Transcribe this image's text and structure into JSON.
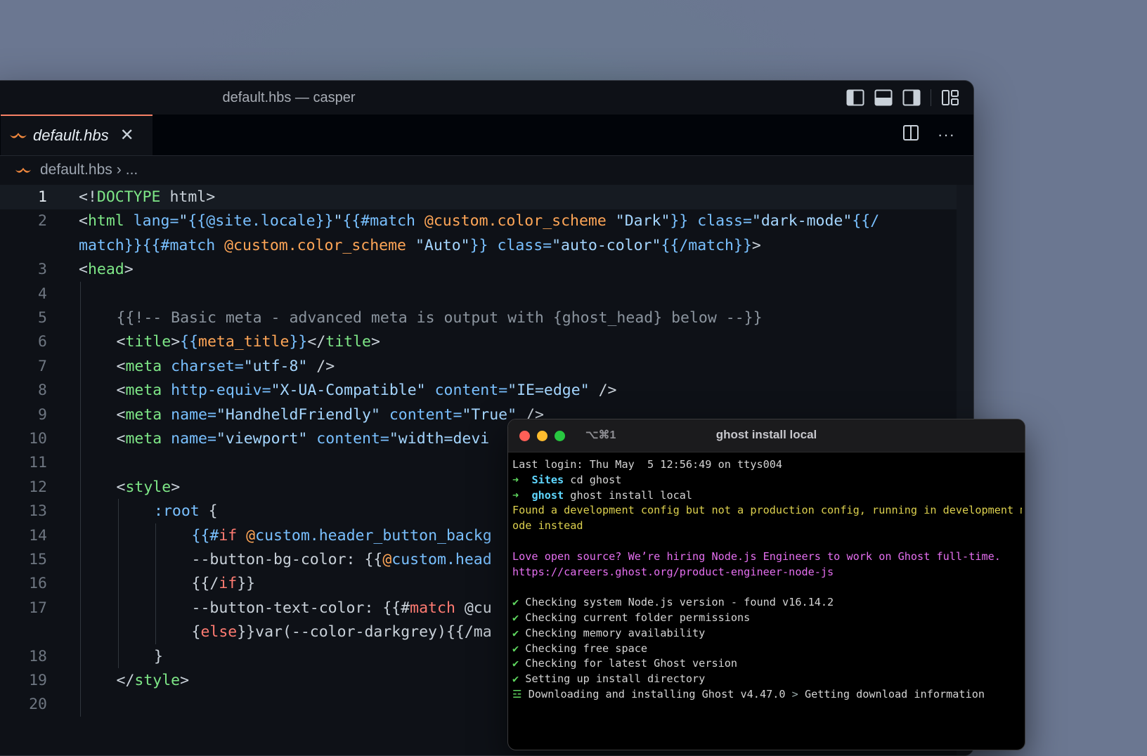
{
  "editor": {
    "window_title": "default.hbs — casper",
    "tab": {
      "label": "default.hbs",
      "close": "✕"
    },
    "more_actions": "···",
    "breadcrumb": {
      "file": "default.hbs",
      "separator": "›",
      "rest": "..."
    }
  },
  "code_lines": [
    {
      "n": "1",
      "indent": 0,
      "tokens": [
        [
          "punc",
          "<!"
        ],
        [
          "tag",
          "DOCTYPE"
        ],
        [
          "punc",
          " html>"
        ]
      ]
    },
    {
      "n": "2",
      "indent": 0,
      "tokens": [
        [
          "punc",
          "<"
        ],
        [
          "tag",
          "html"
        ],
        [
          "attr",
          " lang="
        ],
        [
          "str",
          "\""
        ],
        [
          "hb",
          "{{@site.locale}}"
        ],
        [
          "str",
          "\""
        ],
        [
          "hb",
          "{{#match "
        ],
        [
          "var",
          "@custom.color_scheme"
        ],
        [
          "str",
          " \"Dark\""
        ],
        [
          "hb",
          "}}"
        ],
        [
          "attr",
          " class="
        ],
        [
          "str",
          "\"dark-mode\""
        ],
        [
          "hb",
          "{{/"
        ]
      ]
    },
    {
      "n": "",
      "indent": 0,
      "tokens": [
        [
          "hb",
          "match}}{{#match "
        ],
        [
          "var",
          "@custom.color_scheme"
        ],
        [
          "str",
          " \"Auto\""
        ],
        [
          "hb",
          "}}"
        ],
        [
          "attr",
          " class="
        ],
        [
          "str",
          "\"auto-color\""
        ],
        [
          "hb",
          "{{/match}}"
        ],
        [
          "punc",
          ">"
        ]
      ]
    },
    {
      "n": "3",
      "indent": 0,
      "tokens": [
        [
          "punc",
          "<"
        ],
        [
          "tag",
          "head"
        ],
        [
          "punc",
          ">"
        ]
      ]
    },
    {
      "n": "4",
      "indent": 0,
      "tokens": []
    },
    {
      "n": "5",
      "indent": 1,
      "tokens": [
        [
          "cmt",
          "{{!-- Basic meta - advanced meta is output with {ghost_head} below --}}"
        ]
      ]
    },
    {
      "n": "6",
      "indent": 1,
      "tokens": [
        [
          "punc",
          "<"
        ],
        [
          "tag",
          "title"
        ],
        [
          "punc",
          ">"
        ],
        [
          "hb",
          "{{"
        ],
        [
          "var",
          "meta_title"
        ],
        [
          "hb",
          "}}"
        ],
        [
          "punc",
          "</"
        ],
        [
          "tag",
          "title"
        ],
        [
          "punc",
          ">"
        ]
      ]
    },
    {
      "n": "7",
      "indent": 1,
      "tokens": [
        [
          "punc",
          "<"
        ],
        [
          "tag",
          "meta"
        ],
        [
          "attr",
          " charset="
        ],
        [
          "str",
          "\"utf-8\""
        ],
        [
          "punc",
          " />"
        ]
      ]
    },
    {
      "n": "8",
      "indent": 1,
      "tokens": [
        [
          "punc",
          "<"
        ],
        [
          "tag",
          "meta"
        ],
        [
          "attr",
          " http-equiv="
        ],
        [
          "str",
          "\"X-UA-Compatible\""
        ],
        [
          "attr",
          " content="
        ],
        [
          "str",
          "\"IE=edge\""
        ],
        [
          "punc",
          " />"
        ]
      ]
    },
    {
      "n": "9",
      "indent": 1,
      "tokens": [
        [
          "punc",
          "<"
        ],
        [
          "tag",
          "meta"
        ],
        [
          "attr",
          " name="
        ],
        [
          "str",
          "\"HandheldFriendly\""
        ],
        [
          "attr",
          " content="
        ],
        [
          "str",
          "\"True\""
        ],
        [
          "punc",
          " />"
        ]
      ]
    },
    {
      "n": "10",
      "indent": 1,
      "tokens": [
        [
          "punc",
          "<"
        ],
        [
          "tag",
          "meta"
        ],
        [
          "attr",
          " name="
        ],
        [
          "str",
          "\"viewport\""
        ],
        [
          "attr",
          " content="
        ],
        [
          "str",
          "\"width=devi"
        ]
      ]
    },
    {
      "n": "11",
      "indent": 0,
      "tokens": []
    },
    {
      "n": "12",
      "indent": 1,
      "tokens": [
        [
          "punc",
          "<"
        ],
        [
          "tag",
          "style"
        ],
        [
          "punc",
          ">"
        ]
      ]
    },
    {
      "n": "13",
      "indent": 2,
      "tokens": [
        [
          "attr",
          ":root"
        ],
        [
          "punc",
          " {"
        ]
      ]
    },
    {
      "n": "14",
      "indent": 3,
      "tokens": [
        [
          "hb",
          "{{#"
        ],
        [
          "kw",
          "if"
        ],
        [
          "var",
          " @"
        ],
        [
          "attr",
          "custom.header_button_backg"
        ]
      ]
    },
    {
      "n": "15",
      "indent": 3,
      "tokens": [
        [
          "punc",
          "--button-bg-color: {{"
        ],
        [
          "var",
          "@"
        ],
        [
          "attr",
          "custom.head"
        ]
      ]
    },
    {
      "n": "16",
      "indent": 3,
      "tokens": [
        [
          "punc",
          "{{/"
        ],
        [
          "kw",
          "if"
        ],
        [
          "punc",
          "}}"
        ]
      ]
    },
    {
      "n": "17",
      "indent": 3,
      "tokens": [
        [
          "punc",
          "--button-text-color: {{#"
        ],
        [
          "kw",
          "match"
        ],
        [
          "punc",
          " @cu"
        ]
      ]
    },
    {
      "n": "",
      "indent": 3,
      "tokens": [
        [
          "punc",
          "{"
        ],
        [
          "kw",
          "else"
        ],
        [
          "punc",
          "}}var(--color-darkgrey){{/ma"
        ]
      ]
    },
    {
      "n": "18",
      "indent": 2,
      "tokens": [
        [
          "punc",
          "}"
        ]
      ]
    },
    {
      "n": "19",
      "indent": 1,
      "tokens": [
        [
          "punc",
          "</"
        ],
        [
          "tag",
          "style"
        ],
        [
          "punc",
          ">"
        ]
      ]
    },
    {
      "n": "20",
      "indent": 0,
      "tokens": []
    }
  ],
  "terminal": {
    "shortcut": "⌥⌘1",
    "title": "ghost install local",
    "lines": [
      [
        [
          "plain",
          "Last login: Thu May  5 12:56:49 on ttys004"
        ]
      ],
      [
        [
          "arrow",
          "➜  "
        ],
        [
          "cyan",
          "Sites"
        ],
        [
          "plain",
          " cd ghost"
        ]
      ],
      [
        [
          "arrow",
          "➜  "
        ],
        [
          "cyan",
          "ghost"
        ],
        [
          "plain",
          " ghost install local"
        ]
      ],
      [
        [
          "yellow",
          "Found a development config but not a production config, running in development m"
        ]
      ],
      [
        [
          "yellow",
          "ode instead"
        ]
      ],
      [
        [
          "plain",
          ""
        ]
      ],
      [
        [
          "magenta",
          "Love open source? We’re hiring Node.js Engineers to work on Ghost full-time."
        ]
      ],
      [
        [
          "magenta",
          "https://careers.ghost.org/product-engineer-node-js"
        ]
      ],
      [
        [
          "plain",
          ""
        ]
      ],
      [
        [
          "green",
          "✔"
        ],
        [
          "plain",
          " Checking system Node.js version - found v16.14.2"
        ]
      ],
      [
        [
          "green",
          "✔"
        ],
        [
          "plain",
          " Checking current folder permissions"
        ]
      ],
      [
        [
          "green",
          "✔"
        ],
        [
          "plain",
          " Checking memory availability"
        ]
      ],
      [
        [
          "green",
          "✔"
        ],
        [
          "plain",
          " Checking free space"
        ]
      ],
      [
        [
          "green",
          "✔"
        ],
        [
          "plain",
          " Checking for latest Ghost version"
        ]
      ],
      [
        [
          "green",
          "✔"
        ],
        [
          "plain",
          " Setting up install directory"
        ]
      ],
      [
        [
          "green",
          "☲"
        ],
        [
          "plain",
          " Downloading and installing Ghost v4.47.0 "
        ],
        [
          "dim",
          ">"
        ],
        [
          "plain",
          " Getting download information"
        ]
      ]
    ]
  },
  "colors": {
    "tab_accent": "#f78166",
    "close_dot": "#ff5f57",
    "minimize_dot": "#febc2e",
    "zoom_dot": "#28c840"
  }
}
